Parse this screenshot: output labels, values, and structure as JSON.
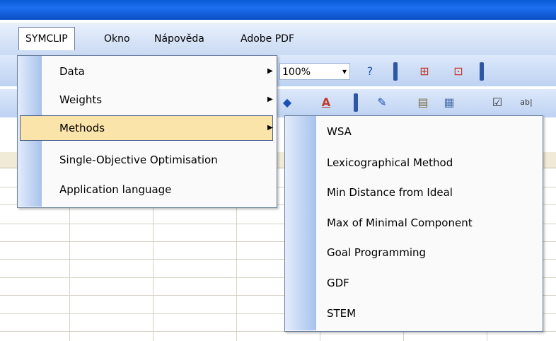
{
  "menubar": {
    "items": [
      "SYMCLIP",
      "Okno",
      "Nápověda",
      "Adobe PDF"
    ]
  },
  "toolbar": {
    "zoom": "100%"
  },
  "dropdown": {
    "items": [
      {
        "label": "Data",
        "submenu": true
      },
      {
        "label": "Weights",
        "submenu": true
      },
      {
        "label": "Methods",
        "submenu": true,
        "highlighted": true
      },
      {
        "label": "Single-Objective Optimisation",
        "submenu": false
      },
      {
        "label": "Application language",
        "submenu": false
      }
    ]
  },
  "submenu": {
    "items": [
      "WSA",
      "Lexicographical Method",
      "Min Distance from Ideal",
      "Max of Minimal Component",
      "Goal Programming",
      "GDF",
      "STEM"
    ]
  },
  "colors": {
    "titlebar": "#1c6ff0",
    "highlight": "#fbe4a9",
    "menu_border": "#6a7f9f"
  }
}
